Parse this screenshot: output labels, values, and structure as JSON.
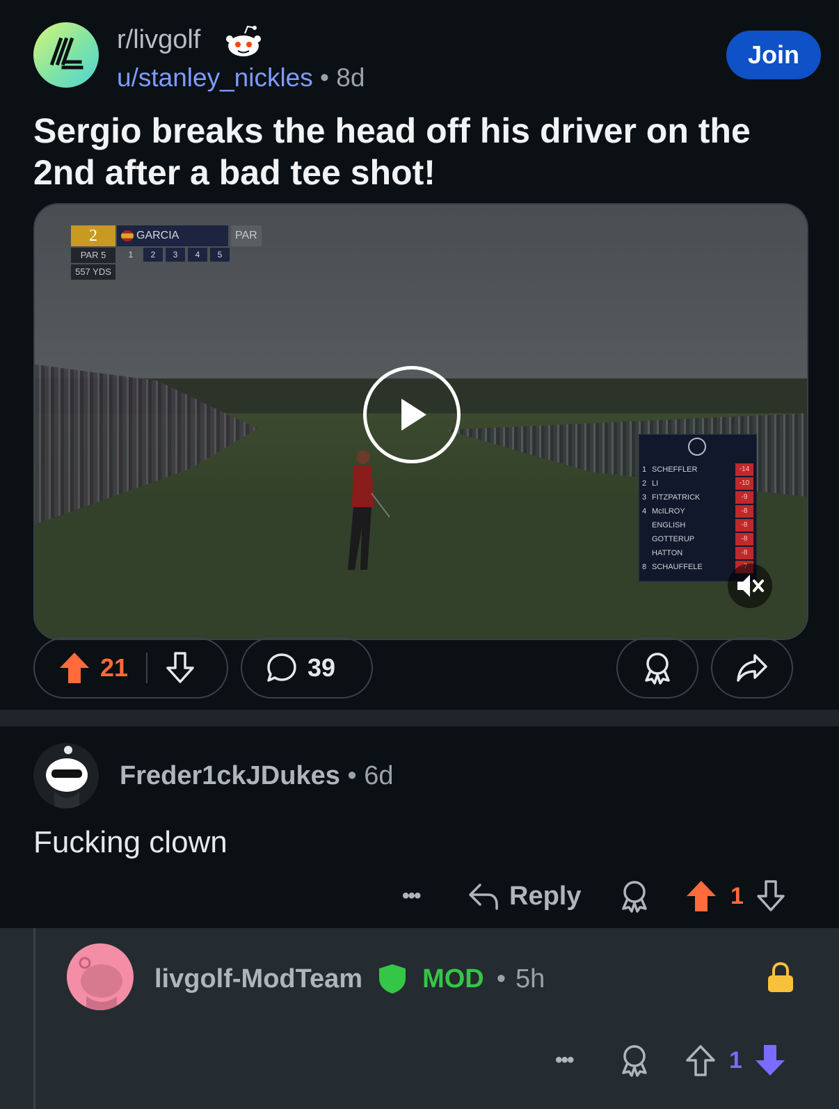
{
  "post": {
    "subreddit": "r/livgolf",
    "author": "u/stanley_nickles",
    "separator": "•",
    "age": "8d",
    "join_label": "Join",
    "title": "Sergio breaks the head off his driver on the 2nd after a bad tee shot!",
    "upvotes": "21",
    "comments": "39"
  },
  "video": {
    "hud": {
      "hole": "2",
      "player": "GARCIA",
      "par_label": "PAR",
      "par": "PAR 5",
      "yards": "557 YDS",
      "holes": [
        "1",
        "2",
        "3",
        "4",
        "5"
      ]
    },
    "leaderboard": [
      {
        "pos": "1",
        "name": "SCHEFFLER",
        "score": "-14"
      },
      {
        "pos": "2",
        "name": "LI",
        "score": "-10"
      },
      {
        "pos": "3",
        "name": "FITZPATRICK",
        "score": "-9"
      },
      {
        "pos": "4",
        "name": "McILROY",
        "score": "-8"
      },
      {
        "pos": "",
        "name": "ENGLISH",
        "score": "-8"
      },
      {
        "pos": "",
        "name": "GOTTERUP",
        "score": "-8"
      },
      {
        "pos": "",
        "name": "HATTON",
        "score": "-8"
      },
      {
        "pos": "8",
        "name": "SCHAUFFELE",
        "score": "-7"
      }
    ]
  },
  "comment": {
    "author": "Freder1ckJDukes",
    "separator": "•",
    "age": "6d",
    "body": "Fucking clown",
    "reply_label": "Reply",
    "more": "•••",
    "score": "1"
  },
  "mod_reply": {
    "author": "livgolf-ModTeam",
    "badge": "MOD",
    "separator": "•",
    "age": "5h",
    "more": "•••",
    "score": "1"
  },
  "colors": {
    "upvote": "#ff6b3a",
    "downvote_active": "#7b6cff",
    "join": "#0f51c6",
    "mod": "#34c646",
    "lock": "#f7c23a"
  },
  "icons": [
    "snoo-icon",
    "upvote-icon",
    "downvote-icon",
    "comment-icon",
    "award-icon",
    "share-icon",
    "play-icon",
    "mute-icon",
    "reply-icon",
    "more-icon",
    "shield-icon",
    "lock-icon"
  ]
}
